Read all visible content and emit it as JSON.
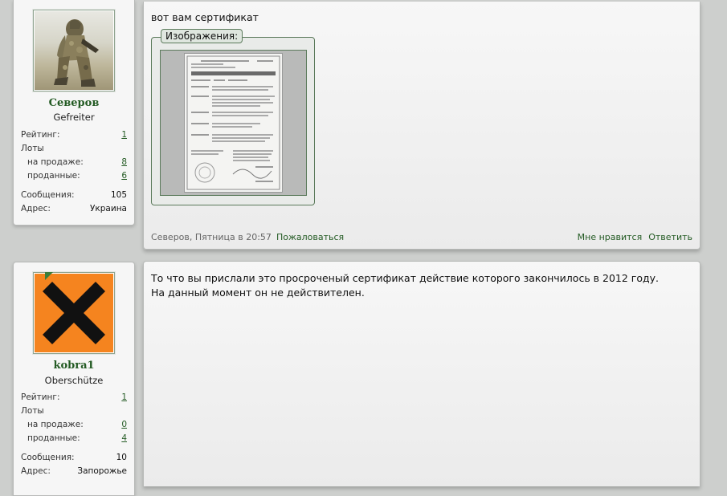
{
  "posts": [
    {
      "user": {
        "name": "Северов",
        "title": "Gefreiter",
        "rating_label": "Рейтинг:",
        "rating": "1",
        "lots_label": "Лоты",
        "for_sale_label": "на продаже:",
        "for_sale": "8",
        "sold_label": "проданные:",
        "sold": "6",
        "messages_label": "Сообщения:",
        "messages": "105",
        "address_label": "Адрес:",
        "address": "Украина"
      },
      "message": "вот вам сертификат",
      "attachments_label": "Изображения:",
      "footer": {
        "meta": "Северов, Пятница в 20:57",
        "report": "Пожаловаться",
        "like": "Мне нравится",
        "reply": "Ответить"
      }
    },
    {
      "user": {
        "name": "kobra1",
        "title": "Oberschütze",
        "rating_label": "Рейтинг:",
        "rating": "1",
        "lots_label": "Лоты",
        "for_sale_label": "на продаже:",
        "for_sale": "0",
        "sold_label": "проданные:",
        "sold": "4",
        "messages_label": "Сообщения:",
        "messages": "10",
        "address_label": "Адрес:",
        "address": "Запорожье"
      },
      "message_line1": "То что вы прислали это просроченый сертификат действие которого закончилось в 2012 году.",
      "message_line2": "На данный момент он не действителен."
    }
  ],
  "colors": {
    "accent": "#245b24",
    "background": "#cdcfcd",
    "panel": "#f6f6f6",
    "hazard_orange": "#f5841f"
  },
  "icons": {
    "avatar_1": "soldier-avatar",
    "avatar_2": "hazard-x-avatar"
  }
}
